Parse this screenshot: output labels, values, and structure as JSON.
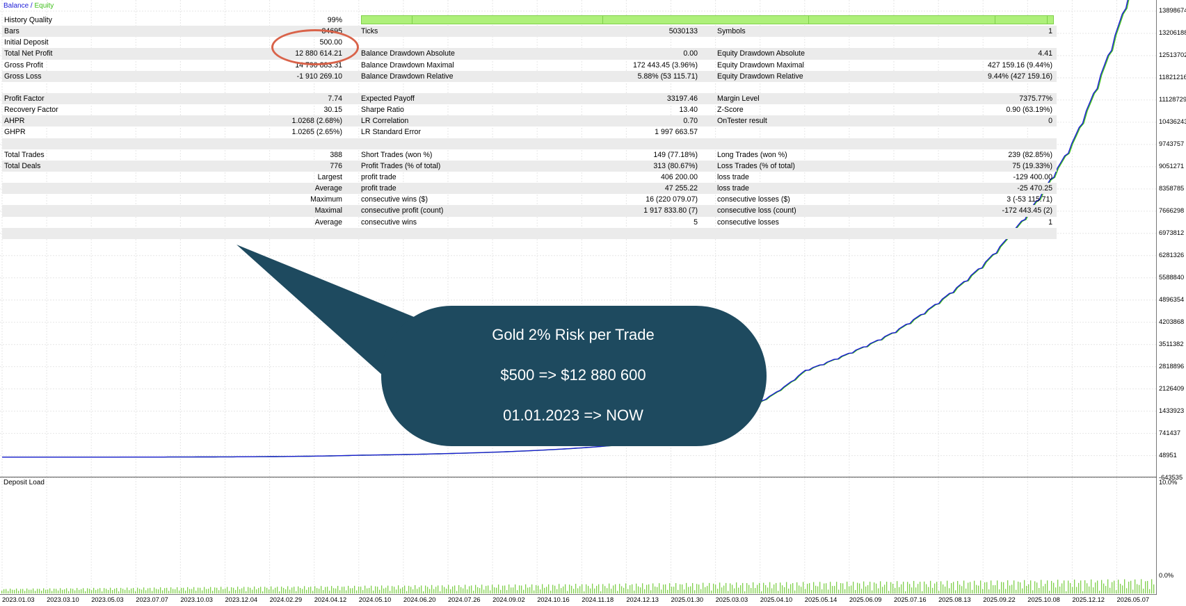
{
  "legend": {
    "balance": "Balance",
    "separator": "/",
    "equity": "Equity"
  },
  "rows": [
    {
      "a": "History Quality",
      "b": "99%",
      "c": "",
      "d": "",
      "e": "",
      "f": "",
      "bar": true
    },
    {
      "a": "Bars",
      "b": "84695",
      "c": "Ticks",
      "d": "5030133",
      "e": "Symbols",
      "f": "1"
    },
    {
      "a": "Initial Deposit",
      "b": "500.00",
      "c": "",
      "d": "",
      "e": "",
      "f": ""
    },
    {
      "a": "Total Net Profit",
      "b": "12 880 614.21",
      "c": "Balance Drawdown Absolute",
      "d": "0.00",
      "e": "Equity Drawdown Absolute",
      "f": "4.41"
    },
    {
      "a": "Gross Profit",
      "b": "14 790 883.31",
      "c": "Balance Drawdown Maximal",
      "d": "172 443.45 (3.96%)",
      "e": "Equity Drawdown Maximal",
      "f": "427 159.16 (9.44%)"
    },
    {
      "a": "Gross Loss",
      "b": "-1 910 269.10",
      "c": "Balance Drawdown Relative",
      "d": "5.88% (53 115.71)",
      "e": "Equity Drawdown Relative",
      "f": "9.44% (427 159.16)"
    },
    {
      "a": "",
      "b": "",
      "c": "",
      "d": "",
      "e": "",
      "f": ""
    },
    {
      "a": "Profit Factor",
      "b": "7.74",
      "c": "Expected Payoff",
      "d": "33197.46",
      "e": "Margin Level",
      "f": "7375.77%"
    },
    {
      "a": "Recovery Factor",
      "b": "30.15",
      "c": "Sharpe Ratio",
      "d": "13.40",
      "e": "Z-Score",
      "f": "0.90 (63.19%)"
    },
    {
      "a": "AHPR",
      "b": "1.0268 (2.68%)",
      "c": "LR Correlation",
      "d": "0.70",
      "e": "OnTester result",
      "f": "0"
    },
    {
      "a": "GHPR",
      "b": "1.0265 (2.65%)",
      "c": "LR Standard Error",
      "d": "1 997 663.57",
      "e": "",
      "f": ""
    },
    {
      "a": "",
      "b": "",
      "c": "",
      "d": "",
      "e": "",
      "f": ""
    },
    {
      "a": "Total Trades",
      "b": "388",
      "c": "Short Trades (won %)",
      "d": "149 (77.18%)",
      "e": "Long Trades (won %)",
      "f": "239 (82.85%)"
    },
    {
      "a": "Total Deals",
      "b": "776",
      "c": "Profit Trades (% of total)",
      "d": "313 (80.67%)",
      "e": "Loss Trades (% of total)",
      "f": "75 (19.33%)"
    },
    {
      "a": "",
      "b": "Largest",
      "c": "profit trade",
      "d": "406 200.00",
      "e": "loss trade",
      "f": "-129 400.00"
    },
    {
      "a": "",
      "b": "Average",
      "c": "profit trade",
      "d": "47 255.22",
      "e": "loss trade",
      "f": "-25 470.25"
    },
    {
      "a": "",
      "b": "Maximum",
      "c": "consecutive wins ($)",
      "d": "16 (220 079.07)",
      "e": "consecutive losses ($)",
      "f": "3 (-53 115.71)"
    },
    {
      "a": "",
      "b": "Maximal",
      "c": "consecutive profit (count)",
      "d": "1 917 833.80 (7)",
      "e": "consecutive loss (count)",
      "f": "-172 443.45 (2)"
    },
    {
      "a": "",
      "b": "Average",
      "c": "consecutive wins",
      "d": "5",
      "e": "consecutive losses",
      "f": "1"
    },
    {
      "a": "",
      "b": "",
      "c": "",
      "d": "",
      "e": "",
      "f": ""
    }
  ],
  "right_axis": [
    "13898674",
    "13206188",
    "12513702",
    "11821216",
    "11128729",
    "10436243",
    "9743757",
    "9051271",
    "8358785",
    "7666298",
    "6973812",
    "6281326",
    "5588840",
    "4896354",
    "4203868",
    "3511382",
    "2818896",
    "2126409",
    "1433923",
    "741437",
    "48951",
    "-643535"
  ],
  "deposit_axis": [
    "10.0%",
    "0.0%"
  ],
  "deposit_label": "Deposit Load",
  "dates": [
    "2023.01.03",
    "2023.03.10",
    "2023.05.03",
    "2023.07.07",
    "2023.10.03",
    "2023.12.04",
    "2024.02.29",
    "2024.04.12",
    "2024.05.10",
    "2024.06.20",
    "2024.07.26",
    "2024.09.02",
    "2024.10.16",
    "2024.11.18",
    "2024.12.13",
    "2025.01.30",
    "2025.03.03",
    "2025.04.10",
    "2025.05.14",
    "2025.06.09",
    "2025.07.16",
    "2025.08.13",
    "2025.09.22",
    "2025.10.08",
    "2025.12.12",
    "2026.05.07"
  ],
  "callout": {
    "line1": "Gold 2% Risk per Trade",
    "line2": "$500 => $12 880 600",
    "line3": "01.01.2023 => NOW",
    "color": "#1e4a5f"
  },
  "colors": {
    "balance": "#1a1ad6",
    "equity": "#3fbf1a",
    "oval": "#d9634a",
    "bars": "#7fd04a"
  },
  "chart_data": {
    "type": "line",
    "series": [
      {
        "name": "Balance",
        "x": [
          "2023.01.03",
          "2024.05.10",
          "2024.12.13",
          "2025.03.03",
          "2025.05.14",
          "2025.07.16",
          "2025.09.22",
          "2025.10.08",
          "2025.12.12",
          "2026.05.07"
        ],
        "values": [
          500,
          60000,
          400000,
          1100000,
          2700000,
          3900000,
          6000000,
          7600000,
          9800000,
          13300000
        ]
      },
      {
        "name": "Equity",
        "x": [
          "2023.01.03",
          "2024.05.10",
          "2024.12.13",
          "2025.03.03",
          "2025.05.14",
          "2025.07.16",
          "2025.09.22",
          "2025.10.08",
          "2025.12.12",
          "2026.05.07"
        ],
        "values": [
          500,
          60000,
          400000,
          1100000,
          2700000,
          3900000,
          6000000,
          7600000,
          9800000,
          13300000
        ]
      }
    ],
    "ylim": [
      -643535,
      13898674
    ]
  }
}
